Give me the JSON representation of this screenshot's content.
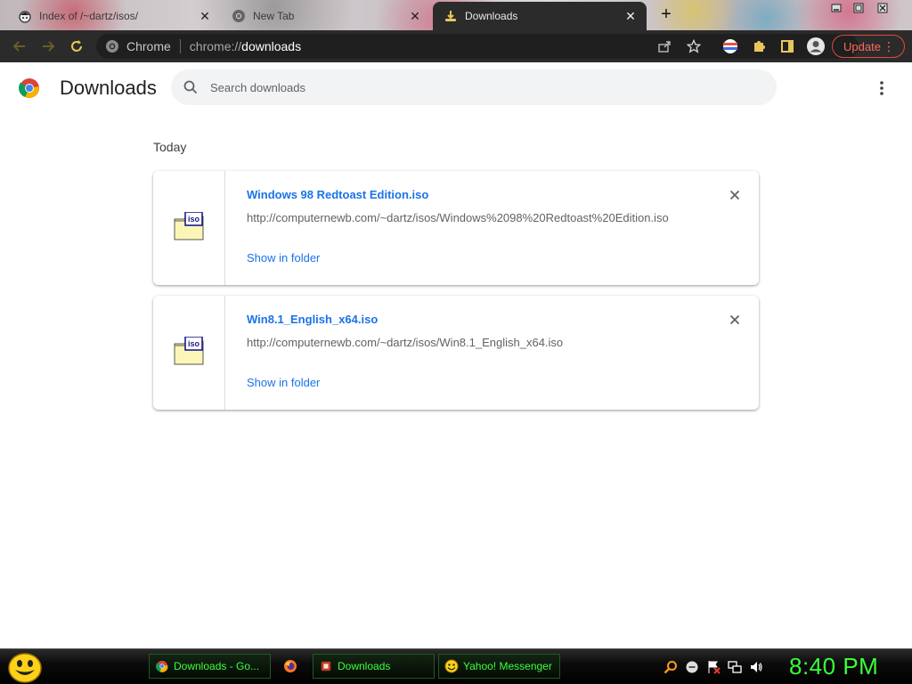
{
  "browser": {
    "tabs": [
      {
        "title": "Index of /~dartz/isos/",
        "icon": "hat-favicon-icon",
        "active": false
      },
      {
        "title": "New Tab",
        "icon": "chrome-favicon-icon",
        "active": false
      },
      {
        "title": "Downloads",
        "icon": "download-favicon-icon",
        "active": true
      }
    ],
    "omnibox": {
      "site_label": "Chrome",
      "url_scheme": "chrome://",
      "url_host": "downloads"
    },
    "update_label": "Update"
  },
  "page": {
    "title": "Downloads",
    "search_placeholder": "Search downloads",
    "date_header": "Today",
    "downloads": [
      {
        "file_name": "Windows 98 Redtoast Edition.iso",
        "url": "http://computernewb.com/~dartz/isos/Windows%2098%20Redtoast%20Edition.iso",
        "action": "Show in folder",
        "icon_label": "iso"
      },
      {
        "file_name": "Win8.1_English_x64.iso",
        "url": "http://computernewb.com/~dartz/isos/Win8.1_English_x64.iso",
        "action": "Show in folder",
        "icon_label": "iso"
      }
    ]
  },
  "taskbar": {
    "buttons": [
      {
        "label": "Downloads - Go...",
        "icon": "chrome-icon"
      },
      {
        "label": "",
        "icon": "firefox-icon"
      },
      {
        "label": "Downloads",
        "icon": "downloads-window-icon"
      },
      {
        "label": "Yahoo! Messenger",
        "icon": "yahoo-messenger-icon"
      }
    ],
    "clock": "8:40 PM"
  },
  "colors": {
    "accent_link": "#1a73e8",
    "toolbar_bg": "#2b2b2b",
    "update_red": "#e04a3b",
    "taskbar_text": "#3cff3c"
  }
}
